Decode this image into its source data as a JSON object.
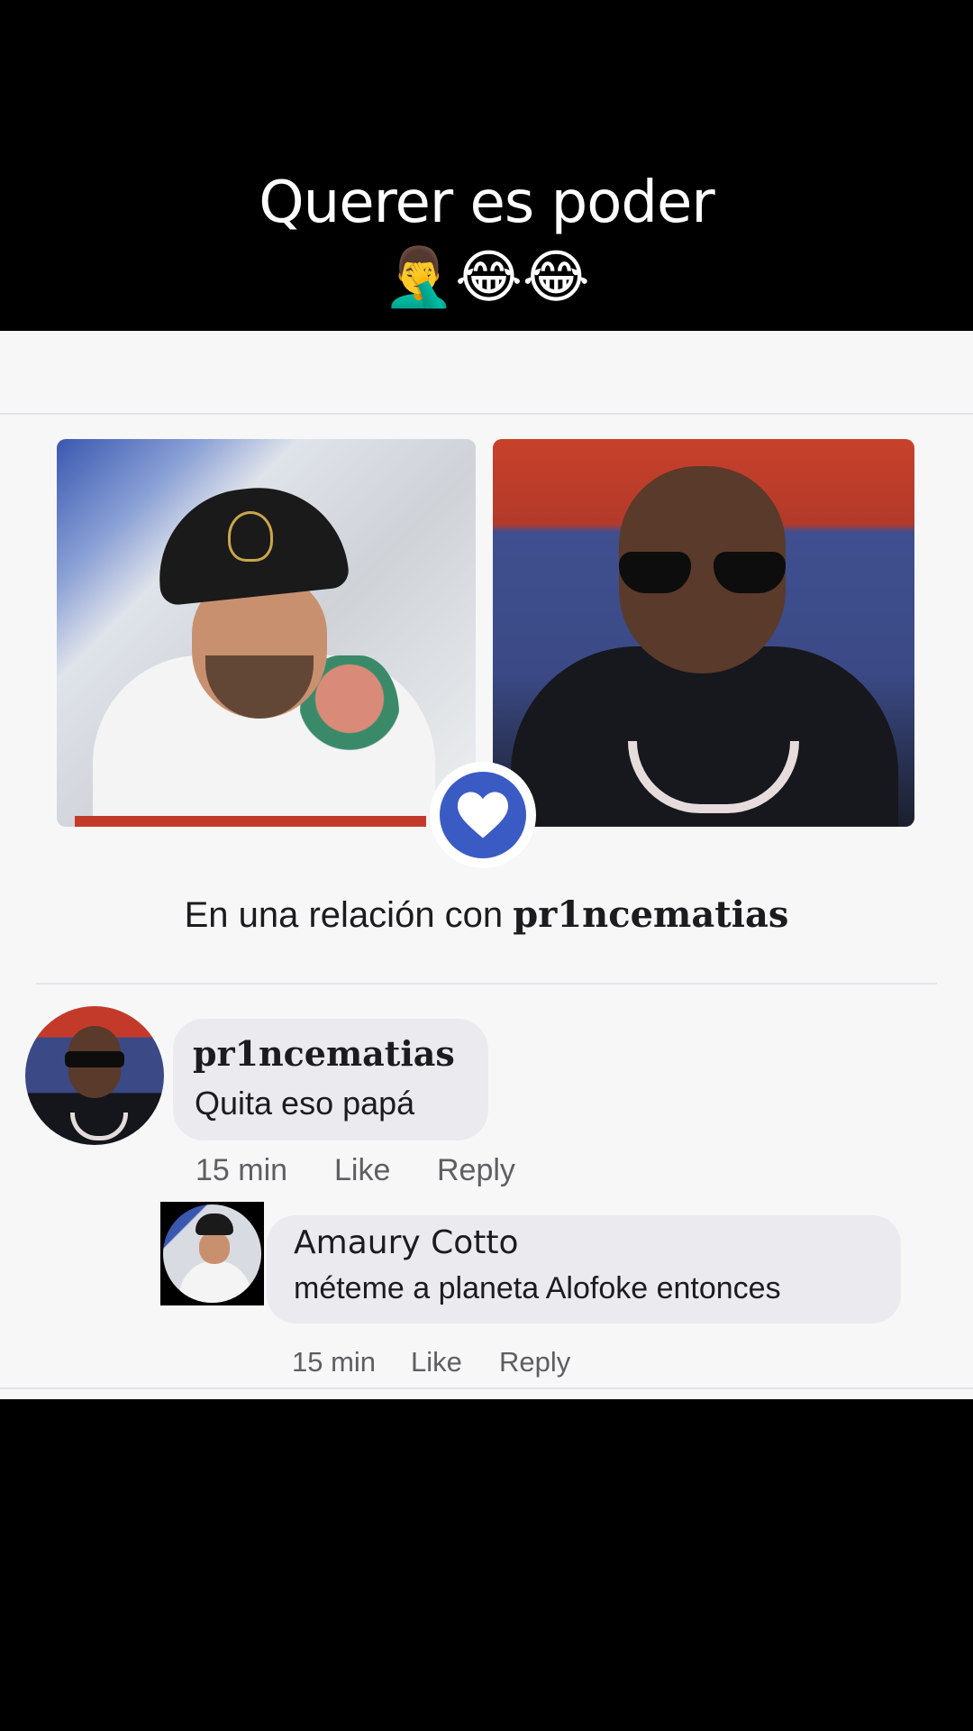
{
  "caption": {
    "title": "Querer es poder",
    "emojis": "🤦‍♂️😂😂"
  },
  "relationship": {
    "prefix": "En una relación con ",
    "partner": "pr1ncematias",
    "icon": "heart-icon"
  },
  "comments": [
    {
      "author": "pr1ncematias",
      "text": "Quita eso papá",
      "time": "15 min",
      "like_label": "Like",
      "reply_label": "Reply"
    },
    {
      "author": "Amaury Cotto",
      "text": "méteme a planeta Alofoke entonces",
      "time": "15 min",
      "like_label": "Like",
      "reply_label": "Reply"
    }
  ],
  "colors": {
    "accent": "#3b5bc4",
    "bubble": "#ebebef",
    "card": "#f7f7f8"
  }
}
